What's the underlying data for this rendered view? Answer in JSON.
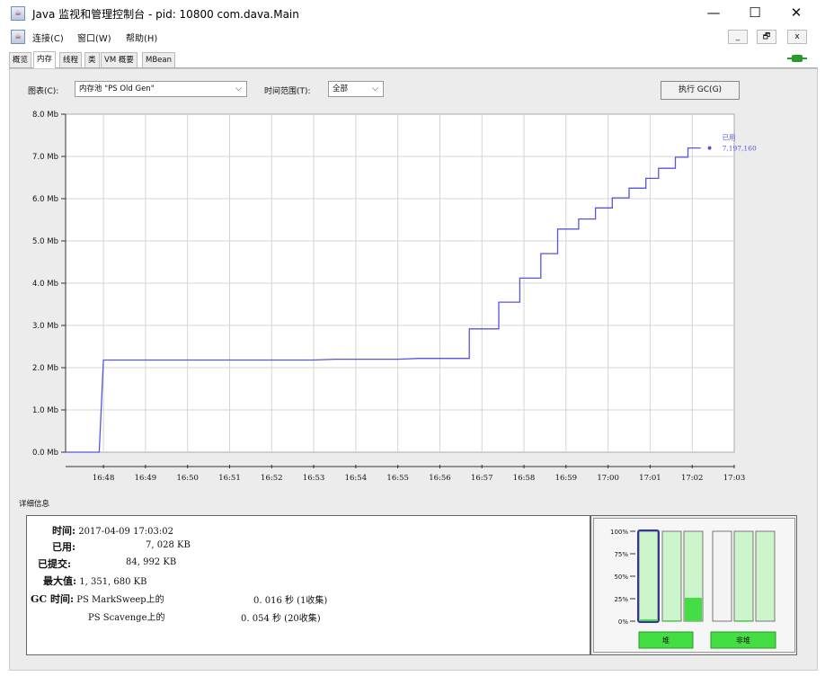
{
  "window": {
    "title": "Java 监视和管理控制台 - pid: 10800 com.dava.Main",
    "minimize": "—",
    "maximize": "☐",
    "close": "✕"
  },
  "menu": {
    "items": [
      {
        "label": "连接(C)"
      },
      {
        "label": "窗口(W)"
      },
      {
        "label": "帮助(H)"
      }
    ],
    "mdi_minimize": "_",
    "mdi_restore": "🗗",
    "mdi_close": "x"
  },
  "tabs": [
    {
      "label": "概览",
      "active": false
    },
    {
      "label": "内存",
      "active": true
    },
    {
      "label": "线程",
      "active": false
    },
    {
      "label": "类",
      "active": false
    },
    {
      "label": "VM 概要",
      "active": false
    },
    {
      "label": "MBean",
      "active": false
    }
  ],
  "controls": {
    "chart_label": "图表(C):",
    "chart_value": "内存池 \"PS Old Gen\"",
    "range_label": "时间范围(T):",
    "range_value": "全部",
    "gc_button": "执行 GC(G)"
  },
  "chart_data": {
    "type": "line",
    "y_ticks": [
      "0.0 Mb",
      "1.0 Mb",
      "2.0 Mb",
      "3.0 Mb",
      "4.0 Mb",
      "5.0 Mb",
      "6.0 Mb",
      "7.0 Mb",
      "8.0 Mb"
    ],
    "ylim": [
      0,
      8
    ],
    "x_ticks": [
      "16:48",
      "16:49",
      "16:50",
      "16:51",
      "16:52",
      "16:53",
      "16:54",
      "16:55",
      "16:56",
      "16:57",
      "16:58",
      "16:59",
      "17:00",
      "17:01",
      "17:02",
      "17:03"
    ],
    "xlim_minutes": [
      -0.9,
      15.0
    ],
    "grid": true,
    "legend_position": "right",
    "series": [
      {
        "name": "已用",
        "last_value": "7,197,160",
        "color": "#5555dd",
        "points": [
          [
            -0.9,
            0.0
          ],
          [
            -0.1,
            0.0
          ],
          [
            0.0,
            2.18
          ],
          [
            5.0,
            2.18
          ],
          [
            5.5,
            2.2
          ],
          [
            7.0,
            2.2
          ],
          [
            7.5,
            2.22
          ],
          [
            8.7,
            2.22
          ],
          [
            8.7,
            2.92
          ],
          [
            9.4,
            2.92
          ],
          [
            9.4,
            3.55
          ],
          [
            9.9,
            3.55
          ],
          [
            9.9,
            4.12
          ],
          [
            10.4,
            4.12
          ],
          [
            10.4,
            4.7
          ],
          [
            10.8,
            4.7
          ],
          [
            10.8,
            5.28
          ],
          [
            11.3,
            5.28
          ],
          [
            11.3,
            5.52
          ],
          [
            11.7,
            5.52
          ],
          [
            11.7,
            5.78
          ],
          [
            12.1,
            5.78
          ],
          [
            12.1,
            6.02
          ],
          [
            12.5,
            6.02
          ],
          [
            12.5,
            6.25
          ],
          [
            12.9,
            6.25
          ],
          [
            12.9,
            6.48
          ],
          [
            13.2,
            6.48
          ],
          [
            13.2,
            6.72
          ],
          [
            13.6,
            6.72
          ],
          [
            13.6,
            6.98
          ],
          [
            13.9,
            6.98
          ],
          [
            13.9,
            7.2
          ],
          [
            14.2,
            7.2
          ]
        ]
      }
    ]
  },
  "details": {
    "label": "详细信息",
    "time_key": "时间:",
    "time_value": "2017-04-09 17:03:02",
    "used_key": "已用:",
    "used_value": "7, 028 KB",
    "committed_key": "已提交:",
    "committed_value": "84, 992 KB",
    "max_key": "最大值:",
    "max_value": "1, 351, 680 KB",
    "gc_key": "GC 时间:",
    "gc_rows": [
      {
        "collector": "PS MarkSweep上的",
        "time": "0. 016 秒 (1收集)"
      },
      {
        "collector": "PS Scavenge上的",
        "time": "0. 054 秒 (20收集)"
      }
    ]
  },
  "pool_bars": {
    "y_ticks": [
      "100%",
      "75%",
      "50%",
      "25%",
      "0%"
    ],
    "heap_label": "堆",
    "nonheap_label": "非堆",
    "heap": [
      0.02,
      0.01,
      0.26
    ],
    "nonheap": [
      0.0,
      0.01,
      0.0
    ],
    "committed_color": "#ccf5cc",
    "used_color": "#44dd44",
    "selected_border": "#3333aa"
  }
}
